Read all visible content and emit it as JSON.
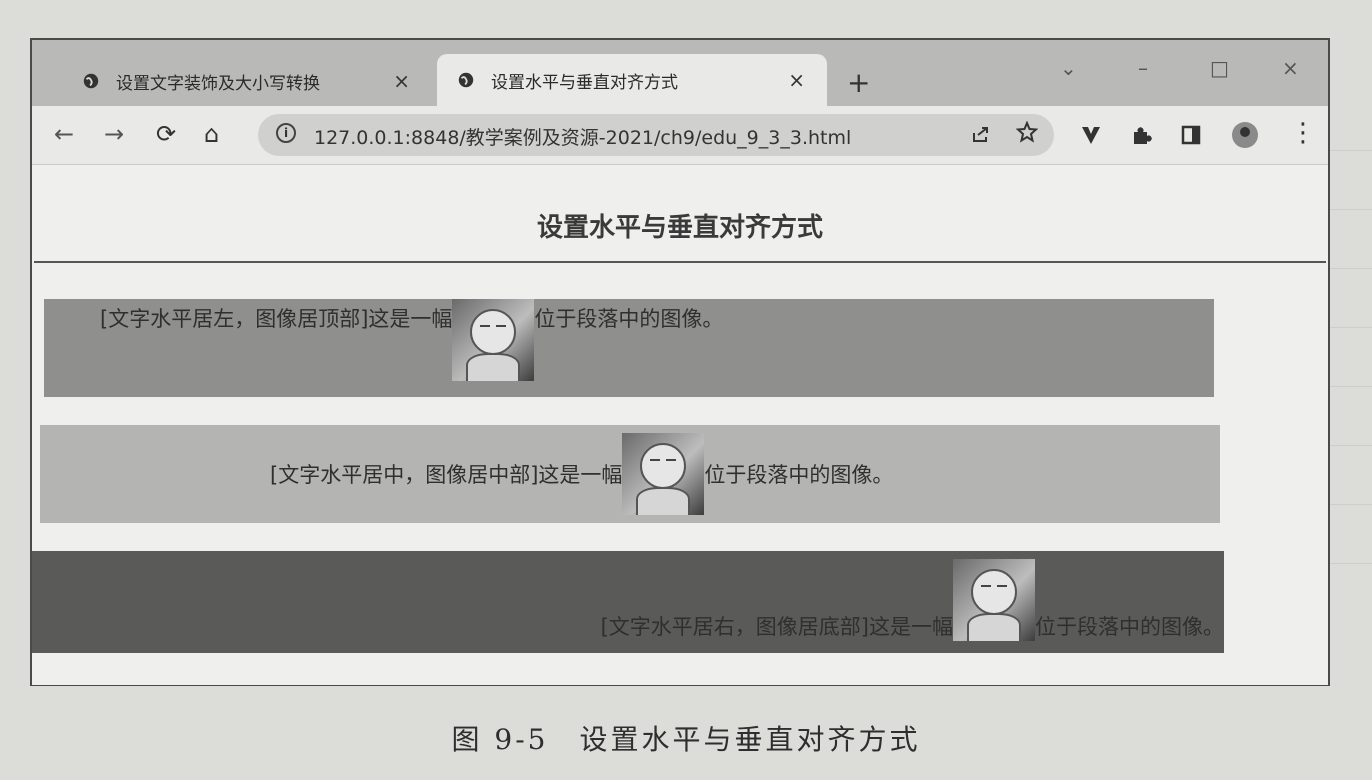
{
  "tabs": [
    {
      "title": "设置文字装饰及大小写转换",
      "close": "×"
    },
    {
      "title": "设置水平与垂直对齐方式",
      "close": "×"
    }
  ],
  "new_tab": "+",
  "window_controls": {
    "dropdown": "⌄",
    "minimize": "–",
    "maximize": "□",
    "close": "×"
  },
  "toolbar": {
    "back": "←",
    "forward": "→",
    "reload": "⟳",
    "home": "⌂",
    "url": "127.0.0.1:8848/教学案例及资源-2021/ch9/edu_9_3_3.html",
    "menu": "⋮"
  },
  "page": {
    "heading": "设置水平与垂直对齐方式",
    "paragraphs": [
      {
        "before": "[文字水平居左，图像居顶部]这是一幅",
        "after": "位于段落中的图像。"
      },
      {
        "before": "[文字水平居中，图像居中部]这是一幅",
        "after": "位于段落中的图像。"
      },
      {
        "before": "[文字水平居右，图像居底部]这是一幅",
        "after": "位于段落中的图像。"
      }
    ]
  },
  "caption": "图 9-5　设置水平与垂直对齐方式"
}
